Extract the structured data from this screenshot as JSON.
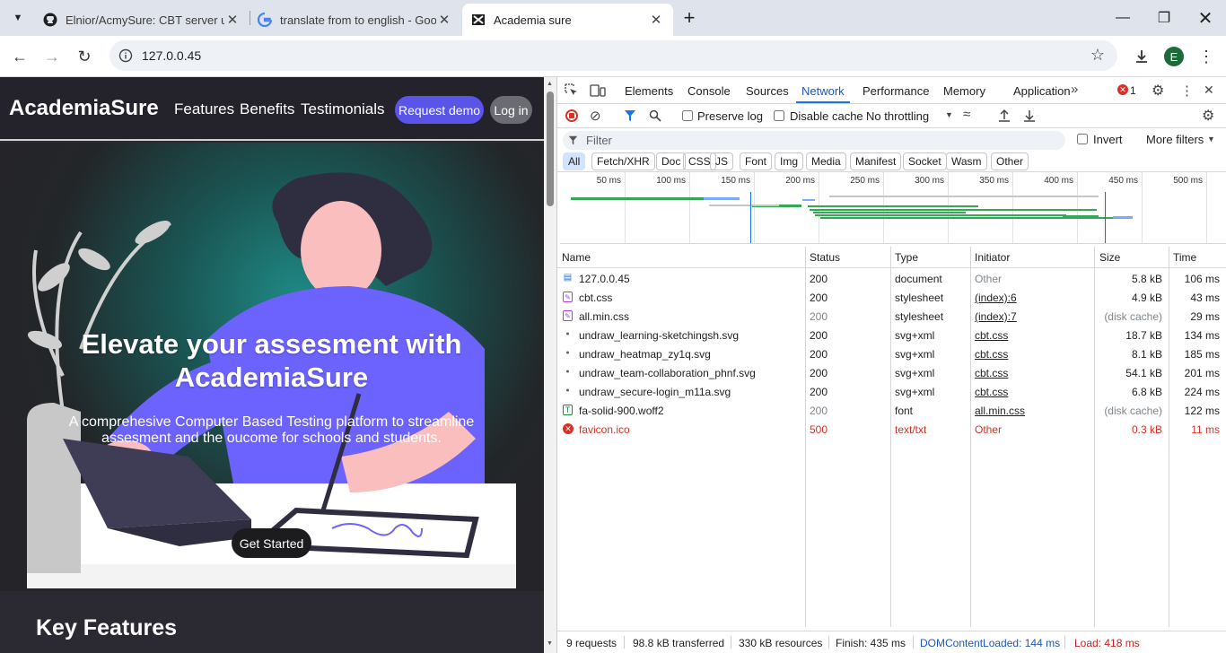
{
  "tabs": [
    {
      "title": "Elnior/AcmySure: CBT server un",
      "icon": "github-icon"
    },
    {
      "title": "translate from to english - Goo",
      "icon": "google-icon"
    },
    {
      "title": "Academia sure",
      "icon": "academia-favicon-icon"
    }
  ],
  "browser": {
    "url": "127.0.0.45",
    "profile_initial": "E"
  },
  "page": {
    "brand": "AcademiaSure",
    "nav": [
      "Features",
      "Benefits",
      "Testimonials"
    ],
    "request_demo": "Request demo",
    "login": "Log in",
    "hero_title": "Elevate your assesment with AcademiaSure",
    "hero_subtitle": "A comprehesive Computer Based Testing platform to streamline assesment and the oucome for schools and students.",
    "cta": "Get Started",
    "key_features": "Key Features"
  },
  "devtools": {
    "tabs": [
      "Elements",
      "Console",
      "Sources",
      "Network",
      "Performance",
      "Memory",
      "Application"
    ],
    "selected_tab": "Network",
    "error_count": "1",
    "preserve_log": "Preserve log",
    "disable_cache": "Disable cache",
    "throttling": "No throttling",
    "filter_placeholder": "Filter",
    "invert": "Invert",
    "more_filters": "More filters",
    "type_filters": [
      "All",
      "Fetch/XHR",
      "Doc",
      "CSS",
      "JS",
      "Font",
      "Img",
      "Media",
      "Manifest",
      "Socket",
      "Wasm",
      "Other"
    ],
    "timeline_ticks": [
      "50 ms",
      "100 ms",
      "150 ms",
      "200 ms",
      "250 ms",
      "300 ms",
      "350 ms",
      "400 ms",
      "450 ms",
      "500 ms"
    ],
    "columns": [
      "Name",
      "Status",
      "Type",
      "Initiator",
      "Size",
      "Time"
    ],
    "requests": [
      {
        "name": "127.0.0.45",
        "status": "200",
        "type": "document",
        "initiator": "Other",
        "size": "5.8 kB",
        "time": "106 ms",
        "icon": "document-icon",
        "state": "normal"
      },
      {
        "name": "cbt.css",
        "status": "200",
        "type": "stylesheet",
        "initiator": "(index):6",
        "size": "4.9 kB",
        "time": "43 ms",
        "icon": "stylesheet-icon",
        "state": "normal"
      },
      {
        "name": "all.min.css",
        "status": "200",
        "type": "stylesheet",
        "initiator": "(index):7",
        "size": "(disk cache)",
        "time": "29 ms",
        "icon": "stylesheet-icon",
        "state": "cached"
      },
      {
        "name": "undraw_learning-sketchingsh.svg",
        "status": "200",
        "type": "svg+xml",
        "initiator": "cbt.css",
        "size": "18.7 kB",
        "time": "134 ms",
        "icon": "image-icon",
        "state": "normal"
      },
      {
        "name": "undraw_heatmap_zy1q.svg",
        "status": "200",
        "type": "svg+xml",
        "initiator": "cbt.css",
        "size": "8.1 kB",
        "time": "185 ms",
        "icon": "image-icon",
        "state": "normal"
      },
      {
        "name": "undraw_team-collaboration_phnf.svg",
        "status": "200",
        "type": "svg+xml",
        "initiator": "cbt.css",
        "size": "54.1 kB",
        "time": "201 ms",
        "icon": "image-icon",
        "state": "normal"
      },
      {
        "name": "undraw_secure-login_m11a.svg",
        "status": "200",
        "type": "svg+xml",
        "initiator": "cbt.css",
        "size": "6.8 kB",
        "time": "224 ms",
        "icon": "image-icon",
        "state": "normal"
      },
      {
        "name": "fa-solid-900.woff2",
        "status": "200",
        "type": "font",
        "initiator": "all.min.css",
        "size": "(disk cache)",
        "time": "122 ms",
        "icon": "font-icon",
        "state": "cached"
      },
      {
        "name": "favicon.ico",
        "status": "500",
        "type": "text/txt",
        "initiator": "Other",
        "size": "0.3 kB",
        "time": "11 ms",
        "icon": "error-icon",
        "state": "error"
      }
    ],
    "summary": {
      "requests": "9 requests",
      "transferred": "98.8 kB transferred",
      "resources": "330 kB resources",
      "finish": "Finish: 435 ms",
      "domcontentloaded": "DOMContentLoaded: 144 ms",
      "load": "Load: 418 ms"
    },
    "colors": {
      "domcontentloaded": "#1a73e8",
      "load": "#d93025",
      "waterfall": "#34a853"
    }
  }
}
